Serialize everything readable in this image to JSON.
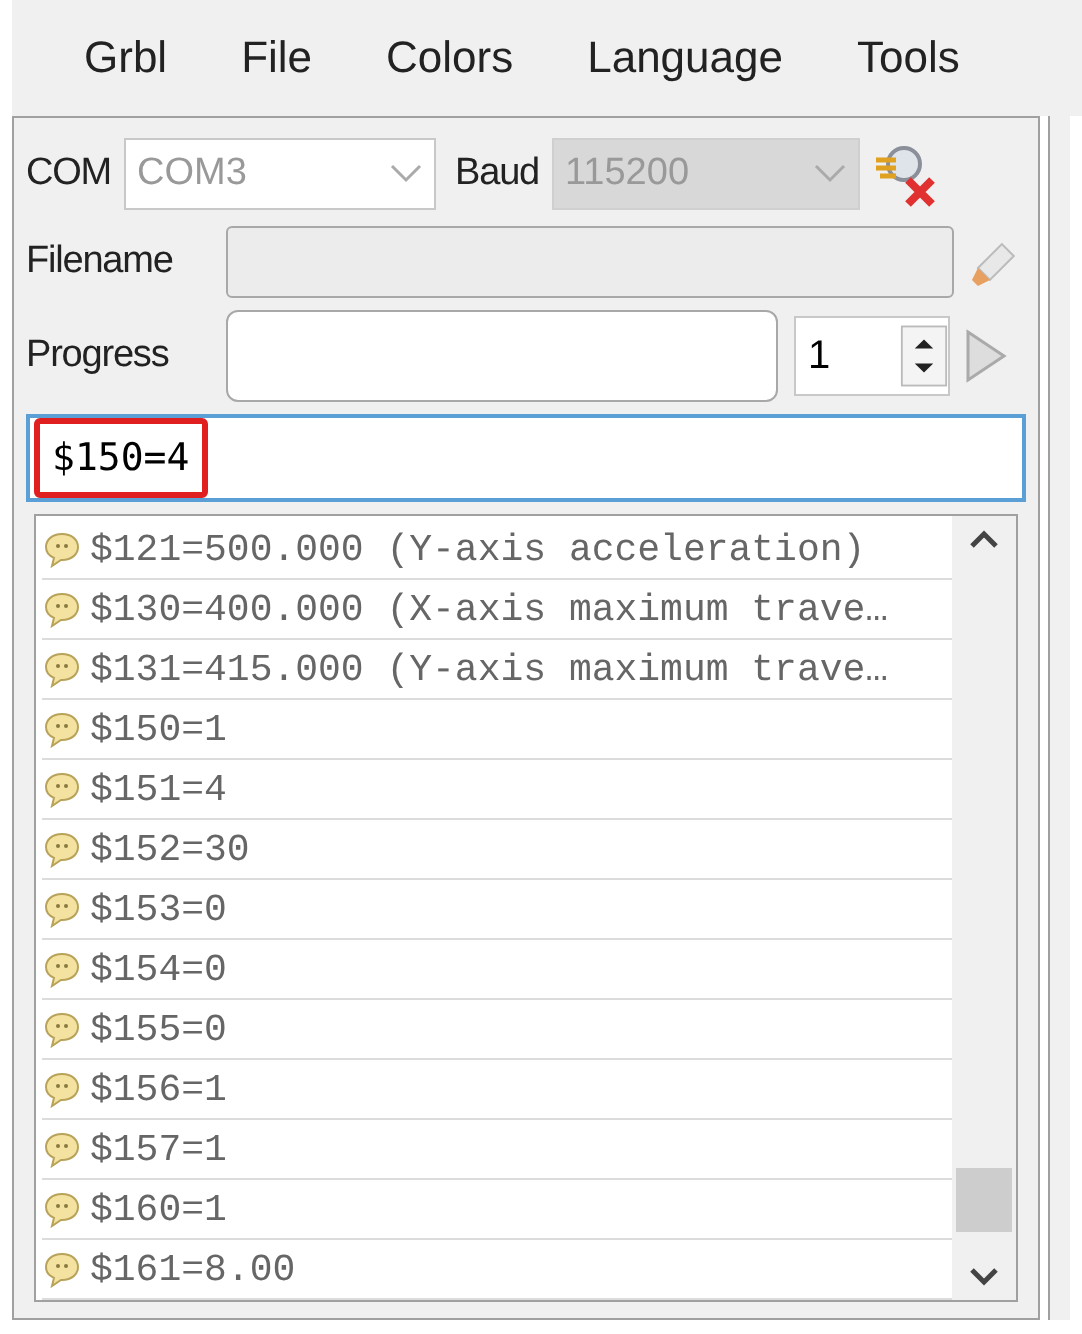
{
  "menu": [
    {
      "label": "Grbl"
    },
    {
      "label": "File"
    },
    {
      "label": "Colors"
    },
    {
      "label": "Language"
    },
    {
      "label": "Tools"
    }
  ],
  "connection": {
    "com_label": "COM",
    "com_value": "COM3",
    "com_disabled": false,
    "baud_label": "Baud",
    "baud_value": "115200",
    "baud_disabled": true
  },
  "file": {
    "label": "Filename"
  },
  "progress": {
    "label": "Progress",
    "repeat": "1"
  },
  "command": {
    "value": "$150=4",
    "highlighted": true
  },
  "log": [
    {
      "text": "$121=500.000 (Y-axis acceleration)"
    },
    {
      "text": "$130=400.000 (X-axis maximum trave…"
    },
    {
      "text": "$131=415.000 (Y-axis maximum trave…"
    },
    {
      "text": "$150=1"
    },
    {
      "text": "$151=4"
    },
    {
      "text": "$152=30"
    },
    {
      "text": "$153=0"
    },
    {
      "text": "$154=0"
    },
    {
      "text": "$155=0"
    },
    {
      "text": "$156=1"
    },
    {
      "text": "$157=1"
    },
    {
      "text": "$160=1"
    },
    {
      "text": "$161=8.00"
    }
  ]
}
